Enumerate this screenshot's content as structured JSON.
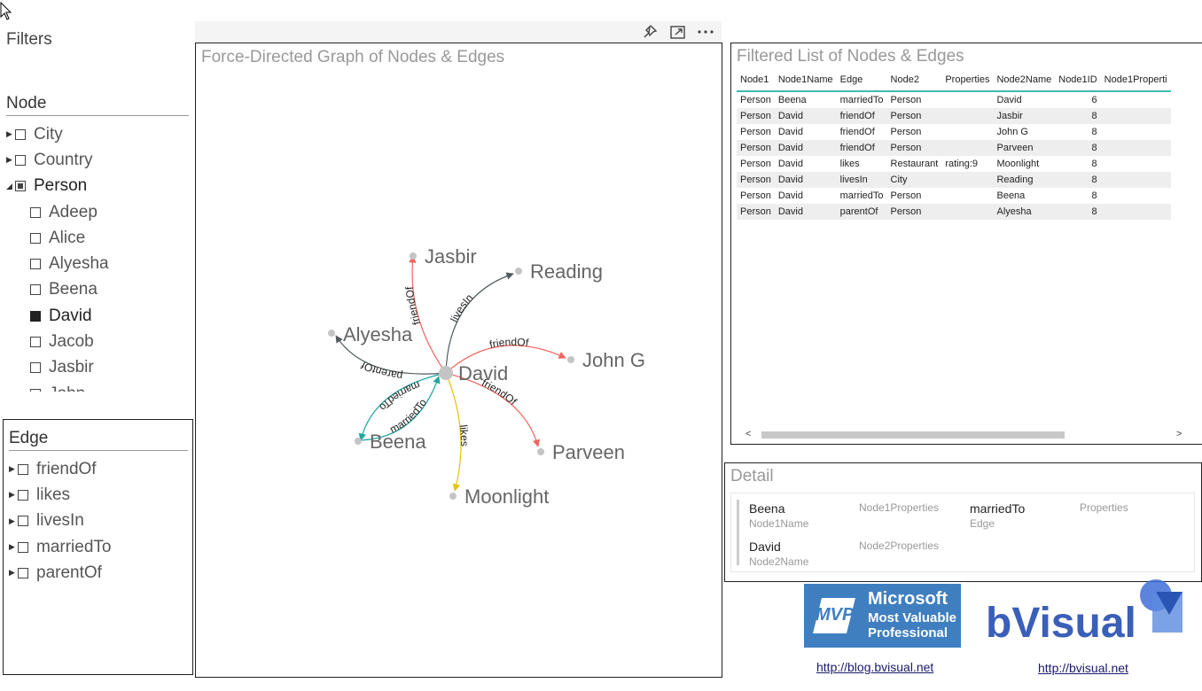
{
  "filters": {
    "title": "Filters",
    "node_slicer": {
      "header": "Node",
      "items": [
        {
          "label": "City",
          "level": 0,
          "expandable": true,
          "expanded": false,
          "state": "unchecked"
        },
        {
          "label": "Country",
          "level": 0,
          "expandable": true,
          "expanded": false,
          "state": "unchecked"
        },
        {
          "label": "Person",
          "level": 0,
          "expandable": true,
          "expanded": true,
          "state": "partial"
        },
        {
          "label": "Adeep",
          "level": 1,
          "state": "unchecked"
        },
        {
          "label": "Alice",
          "level": 1,
          "state": "unchecked"
        },
        {
          "label": "Alyesha",
          "level": 1,
          "state": "unchecked"
        },
        {
          "label": "Beena",
          "level": 1,
          "state": "unchecked"
        },
        {
          "label": "David",
          "level": 1,
          "state": "checked"
        },
        {
          "label": "Jacob",
          "level": 1,
          "state": "unchecked"
        },
        {
          "label": "Jasbir",
          "level": 1,
          "state": "unchecked"
        },
        {
          "label": "John",
          "level": 1,
          "state": "unchecked"
        }
      ]
    },
    "edge_slicer": {
      "header": "Edge",
      "items": [
        {
          "label": "friendOf",
          "state": "unchecked"
        },
        {
          "label": "likes",
          "state": "unchecked"
        },
        {
          "label": "livesIn",
          "state": "unchecked"
        },
        {
          "label": "marriedTo",
          "state": "unchecked"
        },
        {
          "label": "parentOf",
          "state": "unchecked"
        }
      ]
    }
  },
  "toolbar": {
    "pin_icon": "pin-icon",
    "focus_icon": "focus-mode-icon",
    "more_icon": "more-options-icon"
  },
  "graph": {
    "title": "Force-Directed Graph of Nodes & Edges",
    "center": "David",
    "nodes": [
      "David",
      "Jasbir",
      "Reading",
      "Alyesha",
      "John G",
      "Beena",
      "Parveen",
      "Moonlight"
    ],
    "edges": [
      {
        "from": "David",
        "to": "Jasbir",
        "label": "friendOf",
        "color": "#f0645f"
      },
      {
        "from": "David",
        "to": "Reading",
        "label": "livesIn",
        "color": "#505a5e"
      },
      {
        "from": "David",
        "to": "John G",
        "label": "friendOf",
        "color": "#f0645f"
      },
      {
        "from": "David",
        "to": "Parveen",
        "label": "friendOf",
        "color": "#f0645f"
      },
      {
        "from": "David",
        "to": "Moonlight",
        "label": "likes",
        "color": "#e8c000"
      },
      {
        "from": "David",
        "to": "Beena",
        "label": "marriedTo",
        "color": "#1fa59f"
      },
      {
        "from": "Beena",
        "to": "David",
        "label": "marriedTo",
        "color": "#1fa59f"
      },
      {
        "from": "David",
        "to": "Alyesha",
        "label": "parentOf",
        "color": "#505a5e"
      }
    ]
  },
  "table": {
    "title": "Filtered List of Nodes & Edges",
    "columns": [
      "Node1",
      "Node1Name",
      "Edge",
      "Node2",
      "Properties",
      "Node2Name",
      "Node1ID",
      "Node1Properti"
    ],
    "rows": [
      [
        "Person",
        "Beena",
        "marriedTo",
        "Person",
        "",
        "David",
        "6",
        ""
      ],
      [
        "Person",
        "David",
        "friendOf",
        "Person",
        "",
        "Jasbir",
        "8",
        ""
      ],
      [
        "Person",
        "David",
        "friendOf",
        "Person",
        "",
        "John G",
        "8",
        ""
      ],
      [
        "Person",
        "David",
        "friendOf",
        "Person",
        "",
        "Parveen",
        "8",
        ""
      ],
      [
        "Person",
        "David",
        "likes",
        "Restaurant",
        "rating:9",
        "Moonlight",
        "8",
        ""
      ],
      [
        "Person",
        "David",
        "livesIn",
        "City",
        "",
        "Reading",
        "8",
        ""
      ],
      [
        "Person",
        "David",
        "marriedTo",
        "Person",
        "",
        "Beena",
        "8",
        ""
      ],
      [
        "Person",
        "David",
        "parentOf",
        "Person",
        "",
        "Alyesha",
        "8",
        ""
      ]
    ]
  },
  "detail": {
    "title": "Detail",
    "node1name_value": "Beena",
    "node1name_label": "Node1Name",
    "node1properties_label": "Node1Properties",
    "edge_value": "marriedTo",
    "edge_label": "Edge",
    "properties_label": "Properties",
    "node2name_value": "David",
    "node2name_label": "Node2Name",
    "node2properties_label": "Node2Properties"
  },
  "logos": {
    "mvp_line1": "Microsoft",
    "mvp_line2": "Most Valuable",
    "mvp_line3": "Professional",
    "mvp_badge": "MVP",
    "mvp_link": "http://blog.bvisual.net",
    "bvisual_text": "bVisual",
    "bvisual_link": "http://bvisual.net"
  }
}
